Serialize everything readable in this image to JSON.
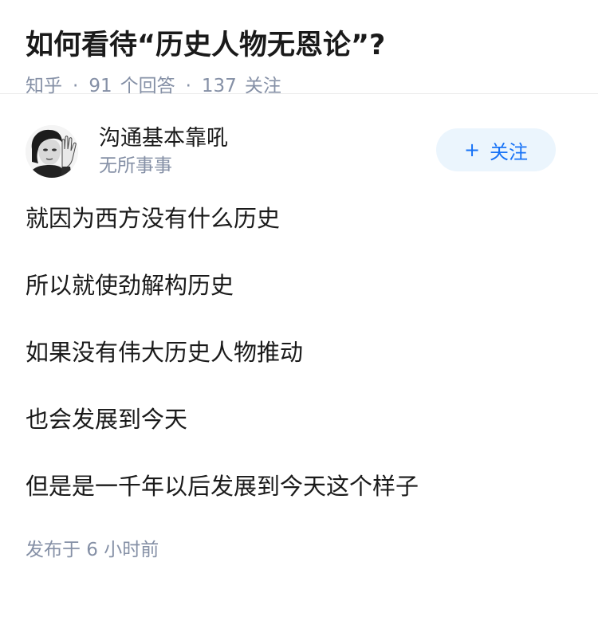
{
  "question": {
    "title": "如何看待“历史人物无恩论”?",
    "source": "知乎",
    "answers_count": "91",
    "answers_label": "个回答",
    "followers_count": "137",
    "followers_label": "关注"
  },
  "answer": {
    "author_name": "沟通基本靠吼",
    "author_bio": "无所事事",
    "follow_label": "关注",
    "follow_icon": "plus-icon",
    "paragraphs": [
      "就因为西方没有什么历史",
      "所以就使劲解构历史",
      "如果没有伟大历史人物推动",
      "也会发展到今天",
      "但是是一千年以后发展到今天这个样子"
    ],
    "published": "发布于  6 小时前"
  },
  "colors": {
    "accent": "#1772f6",
    "accent_bg": "#ebf5fd",
    "muted": "#8590a6",
    "text": "#1a1a1a"
  }
}
